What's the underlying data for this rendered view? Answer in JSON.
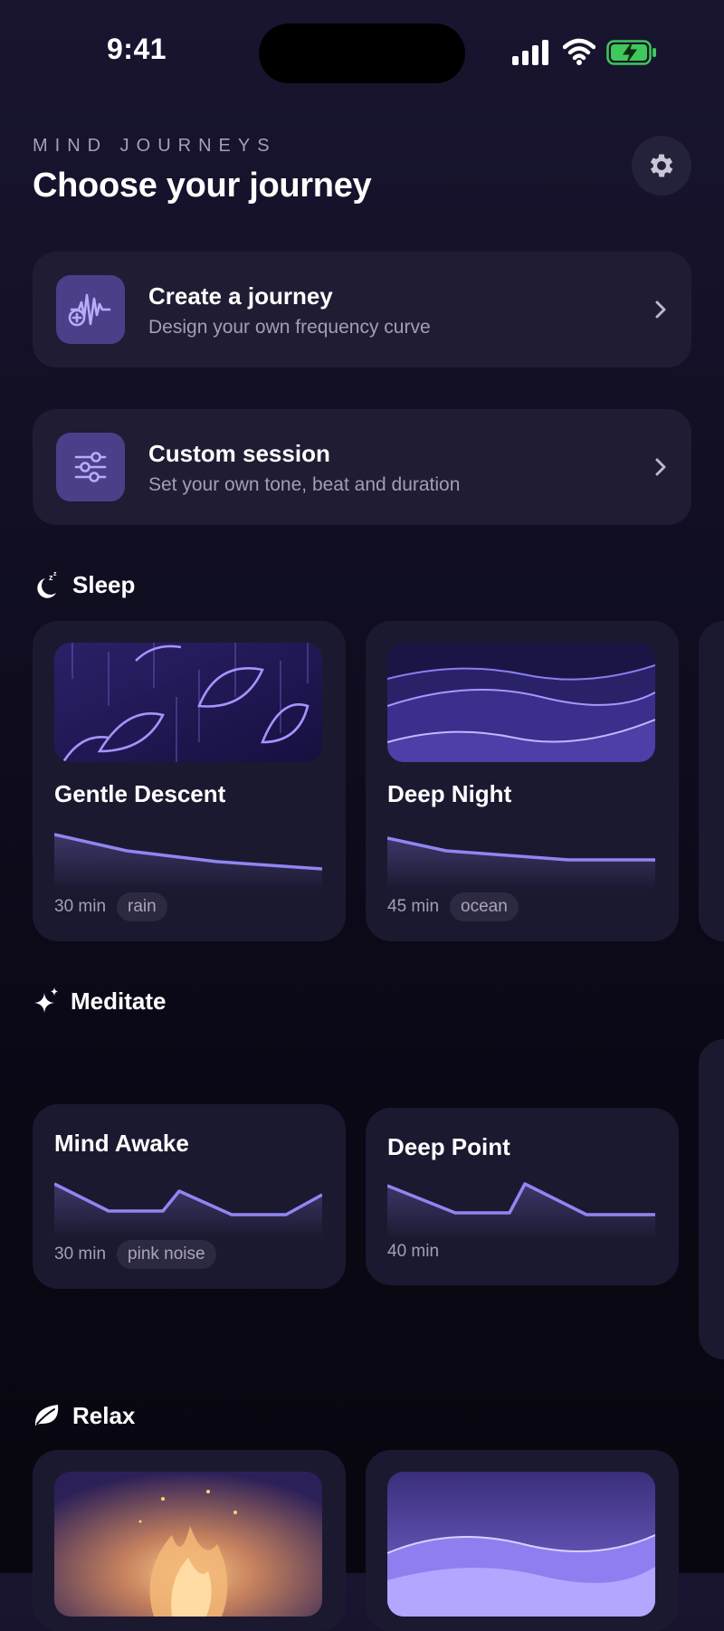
{
  "status": {
    "time": "9:41"
  },
  "header": {
    "eyebrow": "MIND JOURNEYS",
    "title": "Choose your journey"
  },
  "actions": [
    {
      "title": "Create a journey",
      "subtitle": "Design your own frequency curve",
      "icon": "waveform-plus-icon"
    },
    {
      "title": "Custom session",
      "subtitle": "Set your own tone, beat and duration",
      "icon": "sliders-icon"
    }
  ],
  "sections": {
    "sleep": {
      "label": "Sleep",
      "icon": "moon-zzz-icon",
      "cards": [
        {
          "name": "Gentle Descent",
          "duration": "30 min",
          "tag": "rain",
          "curve": [
            0.75,
            0.5,
            0.35,
            0.2,
            0.15,
            0.1
          ]
        },
        {
          "name": "Deep Night",
          "duration": "45 min",
          "tag": "ocean",
          "curve": [
            0.7,
            0.4,
            0.3,
            0.2,
            0.2,
            0.2
          ]
        }
      ]
    },
    "meditate": {
      "label": "Meditate",
      "icon": "sparkles-icon",
      "cards": [
        {
          "name": "Mind Awake",
          "duration": "30 min",
          "tag": "pink noise"
        },
        {
          "name": "Deep Point",
          "duration": "40 min"
        }
      ]
    },
    "relax": {
      "label": "Relax",
      "icon": "leaf-icon"
    }
  },
  "colors": {
    "accent": "#8f86f2",
    "card": "#1b1930",
    "background": "#110e22"
  }
}
